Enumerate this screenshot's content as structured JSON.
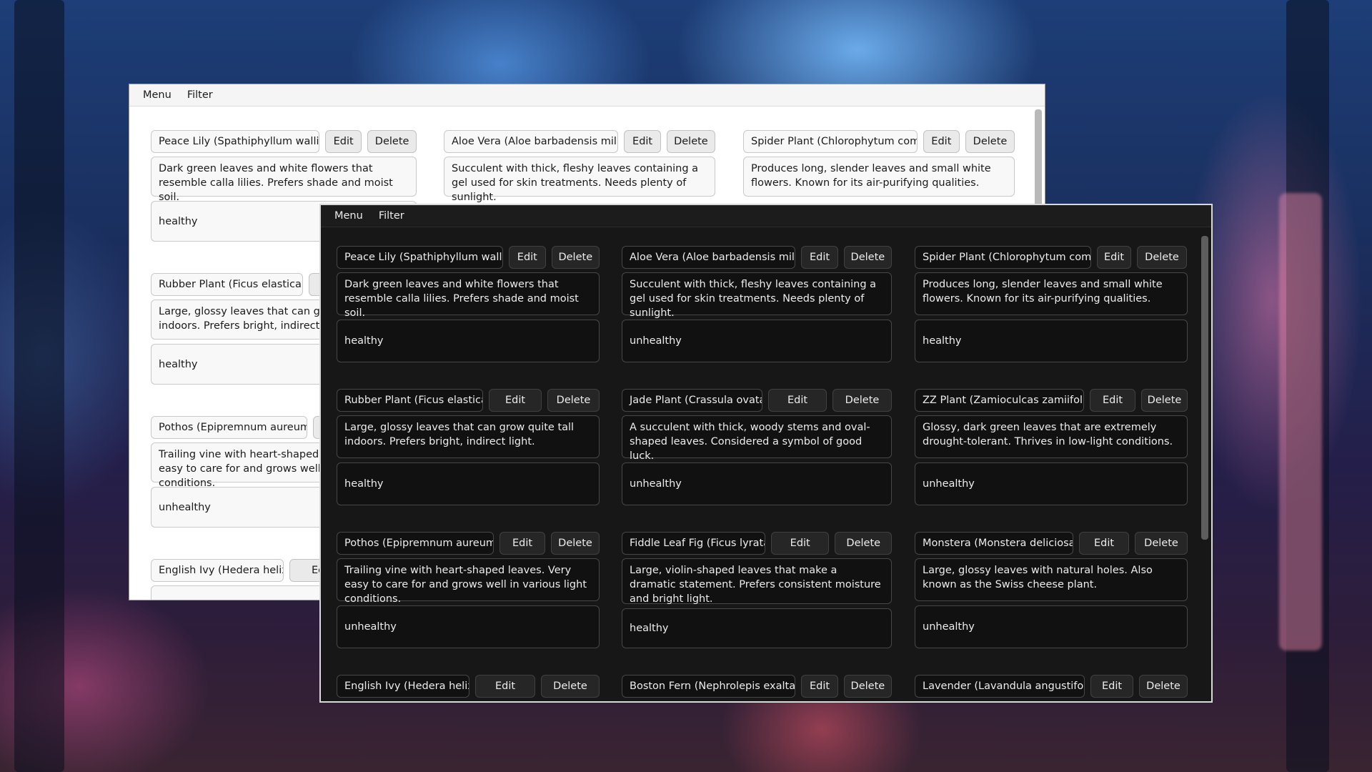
{
  "colors": {
    "dark_bg": "#171717",
    "light_bg": "#ffffff",
    "accent_border": "#d9d9d9"
  },
  "light_window": {
    "menu_label": "Menu",
    "filter_label": "Filter",
    "plants": [
      {
        "name": "Peace Lily (Spathiphyllum wallisii)",
        "edit_label": "Edit",
        "delete_label": "Delete",
        "description": "Dark green leaves and white flowers that resemble calla lilies. Prefers shade and moist soil.",
        "status": "healthy"
      },
      {
        "name": "Aloe Vera (Aloe barbadensis miller)",
        "edit_label": "Edit",
        "delete_label": "Delete",
        "description": "Succulent with thick, fleshy leaves containing a gel used for skin treatments. Needs plenty of sunlight.",
        "status": ""
      },
      {
        "name": "Spider Plant (Chlorophytum comosum)",
        "edit_label": "Edit",
        "delete_label": "Delete",
        "description": "Produces long, slender leaves and small white flowers. Known for its air-purifying qualities.",
        "status": ""
      },
      {
        "name": "Rubber Plant (Ficus elastica)",
        "edit_label": "",
        "delete_label": "",
        "description": "Large, glossy leaves that can grow quite tall indoors. Prefers bright, indirect light.",
        "status": "healthy"
      },
      {
        "name": "Pothos (Epipremnum aureum)",
        "edit_label": "",
        "delete_label": "",
        "description": "Trailing vine with heart-shaped leaves. Very easy to care for and grows well in various light conditions.",
        "status": "unhealthy"
      },
      {
        "name": "English Ivy (Hedera helix)",
        "edit_label": "Ed",
        "delete_label": "",
        "description": "",
        "status": ""
      }
    ]
  },
  "dark_window": {
    "menu_label": "Menu",
    "filter_label": "Filter",
    "plants": [
      {
        "name": "Peace Lily (Spathiphyllum wallisii)",
        "edit_label": "Edit",
        "delete_label": "Delete",
        "description": "Dark green leaves and white flowers that resemble calla lilies. Prefers shade and moist soil.",
        "status": "healthy"
      },
      {
        "name": "Aloe Vera (Aloe barbadensis miller)",
        "edit_label": "Edit",
        "delete_label": "Delete",
        "description": "Succulent with thick, fleshy leaves containing a gel used for skin treatments. Needs plenty of sunlight.",
        "status": "unhealthy"
      },
      {
        "name": "Spider Plant (Chlorophytum comosum)",
        "edit_label": "Edit",
        "delete_label": "Delete",
        "description": "Produces long, slender leaves and small white flowers. Known for its air-purifying qualities.",
        "status": "healthy"
      },
      {
        "name": "Rubber Plant (Ficus elastica)",
        "edit_label": "Edit",
        "delete_label": "Delete",
        "description": "Large, glossy leaves that can grow quite tall indoors. Prefers bright, indirect light.",
        "status": "healthy"
      },
      {
        "name": "Jade Plant (Crassula ovata)",
        "edit_label": "Edit",
        "delete_label": "Delete",
        "description": "A succulent with thick, woody stems and oval-shaped leaves. Considered a symbol of good luck.",
        "status": "unhealthy"
      },
      {
        "name": "ZZ Plant (Zamioculcas zamiifolia)",
        "edit_label": "Edit",
        "delete_label": "Delete",
        "description": "Glossy, dark green leaves that are extremely drought-tolerant. Thrives in low-light conditions.",
        "status": "unhealthy"
      },
      {
        "name": "Pothos (Epipremnum aureum)",
        "edit_label": "Edit",
        "delete_label": "Delete",
        "description": "Trailing vine with heart-shaped leaves. Very easy to care for and grows well in various light conditions.",
        "status": "unhealthy"
      },
      {
        "name": "Fiddle Leaf Fig (Ficus lyrata)",
        "edit_label": "Edit",
        "delete_label": "Delete",
        "description": "Large, violin-shaped leaves that make a dramatic statement. Prefers consistent moisture and bright light.",
        "status": "healthy"
      },
      {
        "name": "Monstera (Monstera deliciosa)",
        "edit_label": "Edit",
        "delete_label": "Delete",
        "description": "Large, glossy leaves with natural holes. Also known as the Swiss cheese plant.",
        "status": "unhealthy"
      },
      {
        "name": "English Ivy (Hedera helix)",
        "edit_label": "Edit",
        "delete_label": "Delete",
        "description": "",
        "status": ""
      },
      {
        "name": "Boston Fern (Nephrolepis exaltata)",
        "edit_label": "Edit",
        "delete_label": "Delete",
        "description": "",
        "status": ""
      },
      {
        "name": "Lavender (Lavandula angustifolia)",
        "edit_label": "Edit",
        "delete_label": "Delete",
        "description": "",
        "status": ""
      }
    ]
  }
}
